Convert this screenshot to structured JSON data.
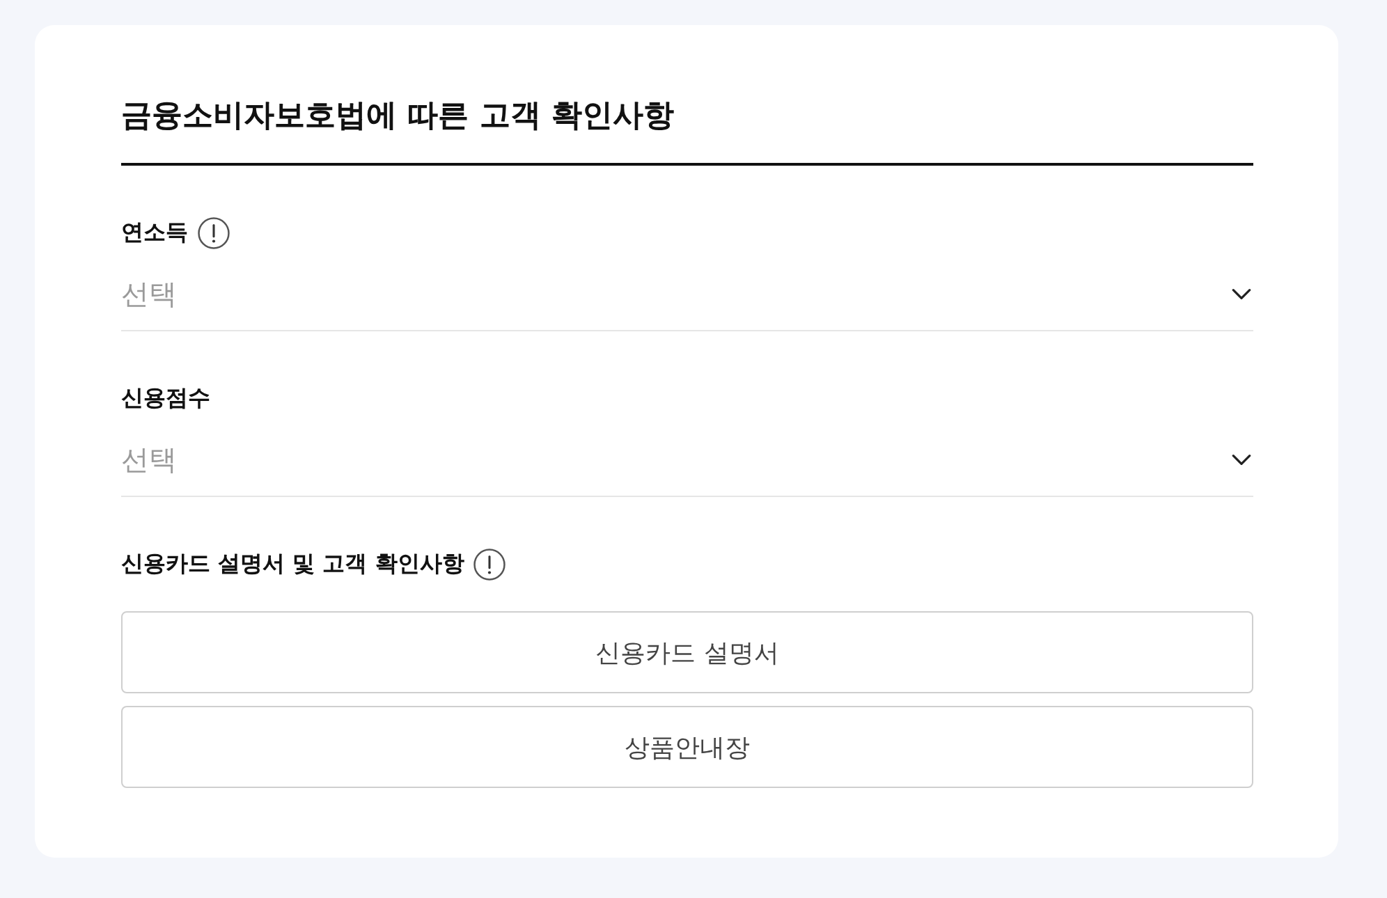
{
  "heading": {
    "title": "금융소비자보호법에 따른 고객 확인사항"
  },
  "fields": [
    {
      "label": "연소득",
      "info": true,
      "placeholder": "선택"
    },
    {
      "label": "신용점수",
      "info": false,
      "placeholder": "선택"
    }
  ],
  "documents": {
    "label": "신용카드 설명서 및 고객 확인사항",
    "info": true,
    "buttons": [
      "신용카드 설명서",
      "상품안내장"
    ]
  }
}
